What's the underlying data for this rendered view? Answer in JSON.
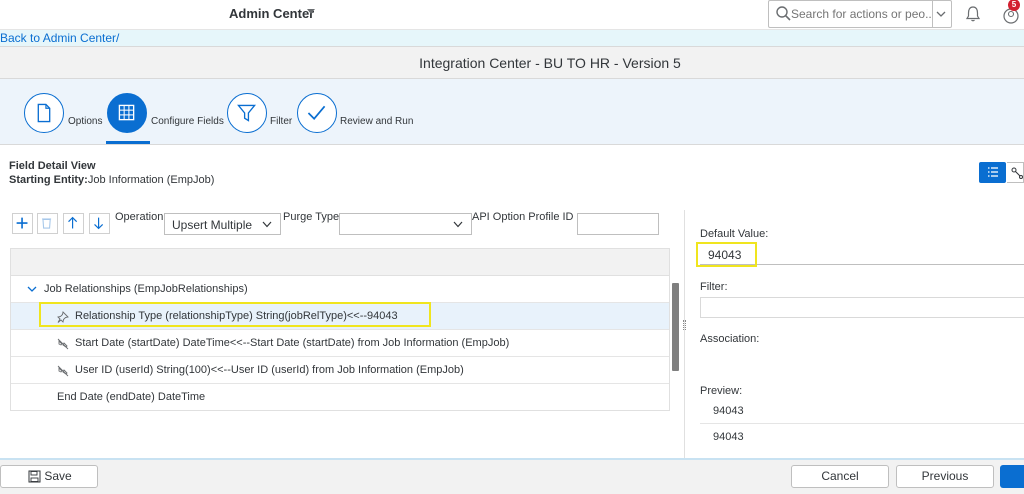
{
  "shell": {
    "title": "Admin Center",
    "search_placeholder": "Search for actions or peo...",
    "notification_count": "5"
  },
  "back_link": "Back to Admin Center/",
  "page_title": "Integration Center - BU TO HR - Version 5",
  "wizard": {
    "steps": [
      {
        "label": "Options",
        "active": false
      },
      {
        "label": "Configure Fields",
        "active": true
      },
      {
        "label": "Filter",
        "active": false
      },
      {
        "label": "Review and Run",
        "active": false
      }
    ]
  },
  "field_detail": {
    "title": "Field Detail View",
    "entity_label": "Starting Entity:",
    "entity_value": "Job Information (EmpJob)"
  },
  "toolbar": {
    "operation_label": "Operation",
    "operation_value": "Upsert Multiple",
    "purge_label": "Purge Type",
    "purge_value": "",
    "api_label": "API Option Profile ID",
    "api_value": ""
  },
  "tree": {
    "group": "Job Relationships (EmpJobRelationships)",
    "rows": [
      "Relationship Type (relationshipType) String(jobRelType)<<--94043",
      "Start Date (startDate) DateTime<<--Start Date (startDate) from Job Information (EmpJob)",
      "User ID (userId) String(100)<<--User ID (userId) from Job Information (EmpJob)",
      "End Date (endDate) DateTime"
    ]
  },
  "details": {
    "default_label": "Default Value:",
    "default_value": "94043",
    "filter_label": "Filter:",
    "association_label": "Association:",
    "preview_label": "Preview:",
    "preview_values": [
      "94043",
      "94043"
    ]
  },
  "footer": {
    "save": "Save",
    "cancel": "Cancel",
    "previous": "Previous"
  },
  "colors": {
    "accent": "#0a6ed1",
    "highlight": "#f0e51e",
    "badge": "#d32030"
  }
}
